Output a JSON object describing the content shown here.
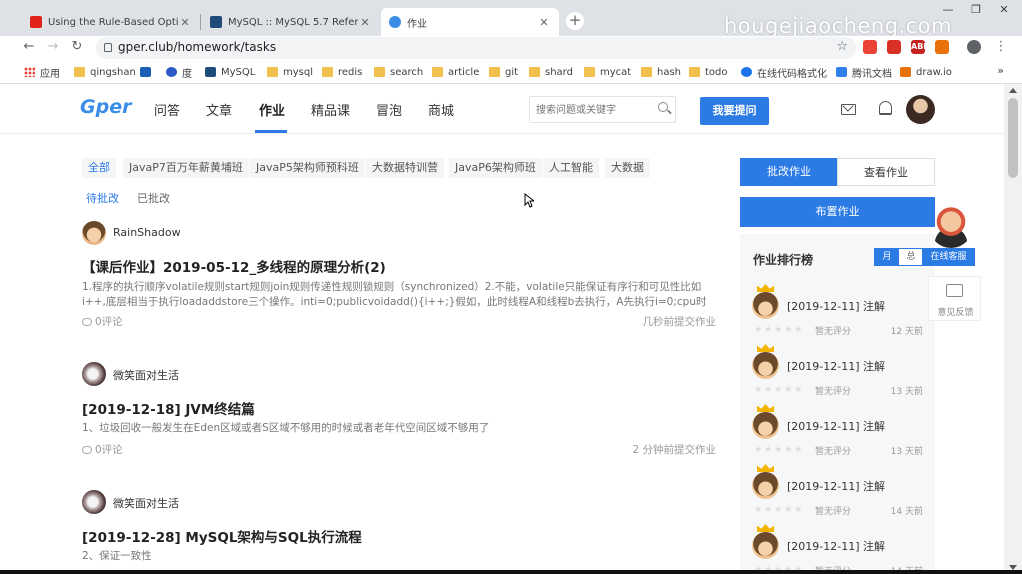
{
  "watermark": "hougejiaocheng.com",
  "browser": {
    "tabs": [
      {
        "title": "Using the Rule-Based Optimiz",
        "favicon": "oracle-icon",
        "color": "#e2231a"
      },
      {
        "title": "MySQL :: MySQL 5.7 Reference",
        "favicon": "mysql-icon",
        "color": "#1f4b7a"
      },
      {
        "title": "作业",
        "favicon": "gper-icon",
        "color": "#3a8ee6"
      }
    ],
    "url": "gper.club/homework/tasks",
    "bookmarks": [
      {
        "label": "应用",
        "icon": "apps-grid-icon"
      },
      {
        "label": "qingshan",
        "icon": "folder-icon"
      },
      {
        "label": "",
        "icon": "on-icon"
      },
      {
        "label": "度",
        "icon": "baidu-icon"
      },
      {
        "label": "MySQL",
        "icon": "mysql-icon"
      },
      {
        "label": "mysql",
        "icon": "folder-icon"
      },
      {
        "label": "redis",
        "icon": "folder-icon"
      },
      {
        "label": "search",
        "icon": "folder-icon"
      },
      {
        "label": "article",
        "icon": "folder-icon"
      },
      {
        "label": "git",
        "icon": "folder-icon"
      },
      {
        "label": "shard",
        "icon": "folder-icon"
      },
      {
        "label": "mycat",
        "icon": "folder-icon"
      },
      {
        "label": "hash",
        "icon": "folder-icon"
      },
      {
        "label": "todo",
        "icon": "folder-icon"
      },
      {
        "label": "在线代码格式化",
        "icon": "code-format-icon"
      },
      {
        "label": "腾讯文档",
        "icon": "tencent-docs-icon"
      },
      {
        "label": "draw.io",
        "icon": "drawio-icon"
      }
    ],
    "bookmarks_more": "»"
  },
  "site": {
    "logo": "Gper",
    "nav": [
      "问答",
      "文章",
      "作业",
      "精品课",
      "冒泡",
      "商城"
    ],
    "active_nav": "作业",
    "search_placeholder": "搜索问题或关键字",
    "ask_button": "我要提问",
    "filters": [
      "全部",
      "JavaP7百万年薪黄埔班",
      "JavaP5架构师预科班",
      "大数据特训营",
      "JavaP6架构师班",
      "人工智能",
      "大数据"
    ],
    "subtabs": [
      "待批改",
      "已批改"
    ],
    "posts": [
      {
        "author": "RainShadow",
        "title": "【课后作业】2019-05-12_多线程的原理分析(2)",
        "excerpt": "1.程序的执行顺序volatile规则start规则join规则传递性规则锁规则（synchronized）2.不能，volatile只能保证有序行和可见性比如i++,底层相当于执行loadaddstore三个操作。inti=0;publicvoidadd(){i++;}假如，此时线程A和线程b去执行，A先执行i=0;cpu时间片切换...",
        "comments": "0评论",
        "time": "几秒前提交作业"
      },
      {
        "author": "微笑面对生活",
        "title": "[2019-12-18] JVM终结篇",
        "excerpt": "1、垃圾回收一般发生在Eden区域或者S区域不够用的时候或者老年代空间区域不够用了",
        "comments": "0评论",
        "time": "2 分钟前提交作业"
      },
      {
        "author": "微笑面对生活",
        "title": "[2019-12-28] MySQL架构与SQL执行流程",
        "excerpt": "2、保证一致性",
        "comments": "",
        "time": ""
      }
    ],
    "right": {
      "tab_on": "批改作业",
      "tab_off": "查看作业",
      "assign_button": "布置作业",
      "rank_title": "作业排行榜",
      "rank_month": "月",
      "rank_total": "总",
      "rank_items": [
        {
          "text": "[2019-12-11] 注解",
          "score": "暂无评分",
          "days": "12 天前"
        },
        {
          "text": "[2019-12-11] 注解",
          "score": "暂无评分",
          "days": "13 天前"
        },
        {
          "text": "[2019-12-11] 注解",
          "score": "暂无评分",
          "days": "13 天前"
        },
        {
          "text": "[2019-12-11] 注解",
          "score": "暂无评分",
          "days": "14 天前"
        },
        {
          "text": "[2019-12-11] 注解",
          "score": "暂无评分",
          "days": "14 天前"
        }
      ]
    },
    "float": {
      "service": "在线客服",
      "feedback": "意见反馈"
    }
  }
}
